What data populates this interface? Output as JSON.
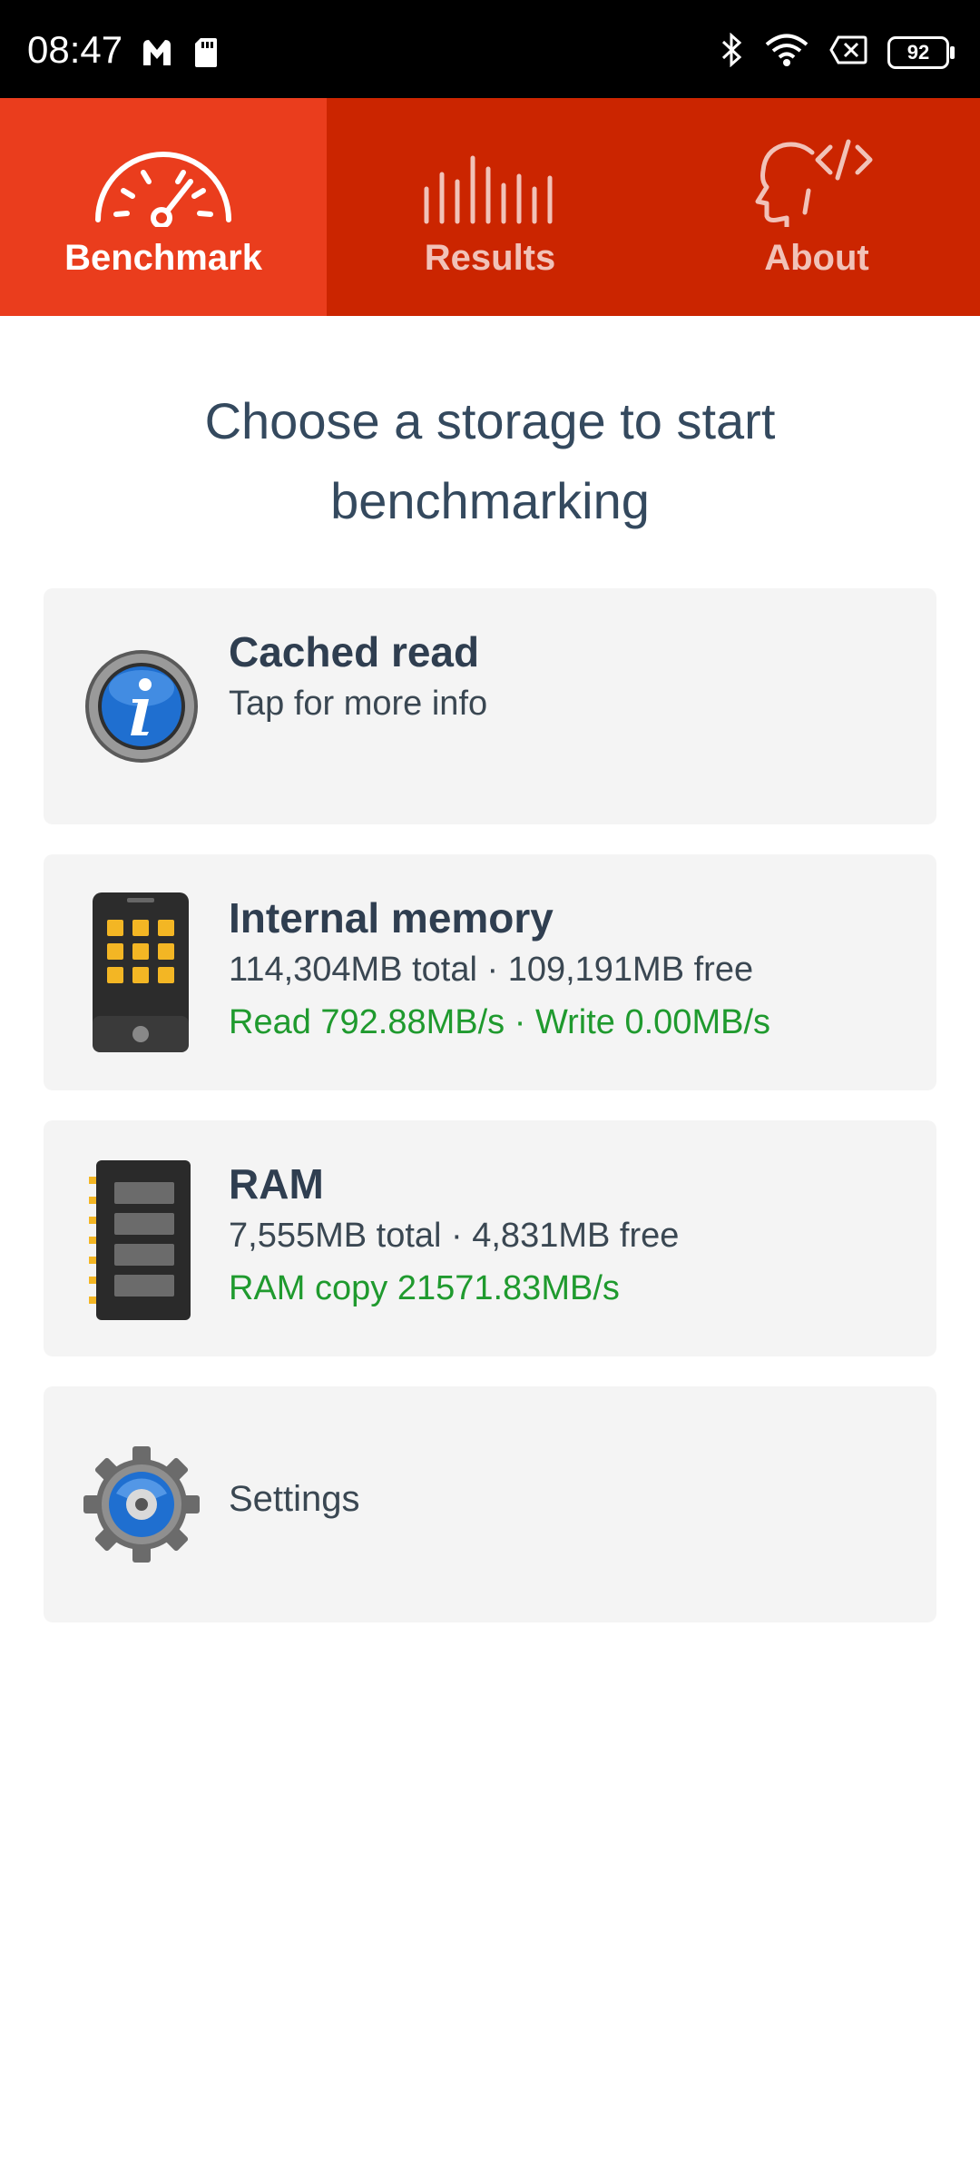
{
  "status_bar": {
    "time": "08:47",
    "battery": "92",
    "icons": [
      "malwarebytes-icon",
      "sd-card-icon",
      "bluetooth-icon",
      "wifi-icon",
      "no-sim-icon",
      "battery-icon"
    ]
  },
  "tabs": [
    {
      "label": "Benchmark",
      "icon": "speedometer-icon",
      "active": true
    },
    {
      "label": "Results",
      "icon": "bars-icon",
      "active": false
    },
    {
      "label": "About",
      "icon": "head-code-icon",
      "active": false
    }
  ],
  "heading": "Choose a storage to start benchmarking",
  "cards": {
    "cached": {
      "title": "Cached read",
      "subtitle": "Tap for more info",
      "icon": "info-icon"
    },
    "internal": {
      "title": "Internal memory",
      "stats": "114,304MB total · 109,191MB free",
      "speed": "Read 792.88MB/s · Write 0.00MB/s",
      "icon": "phone-icon"
    },
    "ram": {
      "title": "RAM",
      "stats": "7,555MB total · 4,831MB free",
      "speed": "RAM copy 21571.83MB/s",
      "icon": "ram-chip-icon"
    },
    "settings": {
      "label": "Settings",
      "icon": "gear-icon"
    }
  },
  "colors": {
    "tab_bar": "#cb2500",
    "tab_active": "#ea3d1d",
    "speed_text": "#1f9a2e",
    "heading_text": "#34495e"
  }
}
